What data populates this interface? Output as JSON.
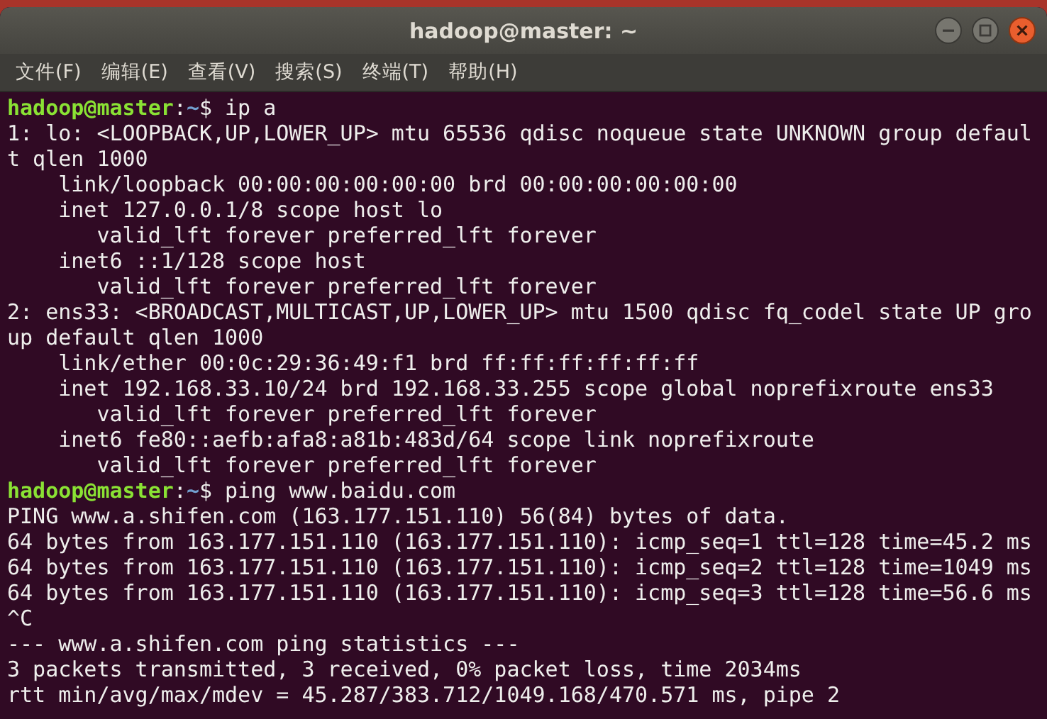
{
  "window": {
    "title": "hadoop@master: ~"
  },
  "menu": [
    {
      "label": "文件(F)"
    },
    {
      "label": "编辑(E)"
    },
    {
      "label": "查看(V)"
    },
    {
      "label": "搜索(S)"
    },
    {
      "label": "终端(T)"
    },
    {
      "label": "帮助(H)"
    }
  ],
  "terminal": {
    "lines": [
      {
        "kind": "prompt",
        "user": "hadoop@master",
        "separator": ":",
        "path": "~",
        "symbol": "$",
        "command": "ip a"
      },
      {
        "kind": "output",
        "text": "1: lo: <LOOPBACK,UP,LOWER_UP> mtu 65536 qdisc noqueue state UNKNOWN group defaul"
      },
      {
        "kind": "output",
        "text": "t qlen 1000"
      },
      {
        "kind": "output",
        "text": "    link/loopback 00:00:00:00:00:00 brd 00:00:00:00:00:00"
      },
      {
        "kind": "output",
        "text": "    inet 127.0.0.1/8 scope host lo"
      },
      {
        "kind": "output",
        "text": "       valid_lft forever preferred_lft forever"
      },
      {
        "kind": "output",
        "text": "    inet6 ::1/128 scope host"
      },
      {
        "kind": "output",
        "text": "       valid_lft forever preferred_lft forever"
      },
      {
        "kind": "output",
        "text": "2: ens33: <BROADCAST,MULTICAST,UP,LOWER_UP> mtu 1500 qdisc fq_codel state UP gro"
      },
      {
        "kind": "output",
        "text": "up default qlen 1000"
      },
      {
        "kind": "output",
        "text": "    link/ether 00:0c:29:36:49:f1 brd ff:ff:ff:ff:ff:ff"
      },
      {
        "kind": "output",
        "text": "    inet 192.168.33.10/24 brd 192.168.33.255 scope global noprefixroute ens33"
      },
      {
        "kind": "output",
        "text": "       valid_lft forever preferred_lft forever"
      },
      {
        "kind": "output",
        "text": "    inet6 fe80::aefb:afa8:a81b:483d/64 scope link noprefixroute"
      },
      {
        "kind": "output",
        "text": "       valid_lft forever preferred_lft forever"
      },
      {
        "kind": "prompt",
        "user": "hadoop@master",
        "separator": ":",
        "path": "~",
        "symbol": "$",
        "command": "ping www.baidu.com"
      },
      {
        "kind": "output",
        "text": "PING www.a.shifen.com (163.177.151.110) 56(84) bytes of data."
      },
      {
        "kind": "output",
        "text": "64 bytes from 163.177.151.110 (163.177.151.110): icmp_seq=1 ttl=128 time=45.2 ms"
      },
      {
        "kind": "output",
        "text": "64 bytes from 163.177.151.110 (163.177.151.110): icmp_seq=2 ttl=128 time=1049 ms"
      },
      {
        "kind": "output",
        "text": "64 bytes from 163.177.151.110 (163.177.151.110): icmp_seq=3 ttl=128 time=56.6 ms"
      },
      {
        "kind": "output",
        "text": "^C"
      },
      {
        "kind": "output",
        "text": "--- www.a.shifen.com ping statistics ---"
      },
      {
        "kind": "output",
        "text": "3 packets transmitted, 3 received, 0% packet loss, time 2034ms"
      },
      {
        "kind": "output",
        "text": "rtt min/avg/max/mdev = 45.287/383.712/1049.168/470.571 ms, pipe 2"
      }
    ]
  }
}
